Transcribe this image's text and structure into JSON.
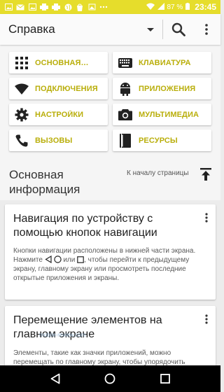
{
  "status_bar": {
    "battery": "87 %",
    "time": "23:45",
    "left_icons": [
      "image-icon",
      "mail-icon",
      "image-icon",
      "printer-icon",
      "printer-icon",
      "globe-icon",
      "shopping-bag-icon",
      "photo-icon",
      "ellipsis-icon"
    ],
    "right_icons": [
      "wifi-icon",
      "signal-icon",
      "battery-icon"
    ]
  },
  "appbar": {
    "title": "Справка",
    "icons": [
      "chevron-down-icon",
      "search-icon",
      "more-vert-icon"
    ]
  },
  "categories": [
    {
      "label": "ОСНОВНАЯ…",
      "icon": "grid-icon"
    },
    {
      "label": "КЛАВИАТУРА",
      "icon": "keyboard-icon"
    },
    {
      "label": "ПОДКЛЮЧЕНИЯ",
      "icon": "wifi-icon"
    },
    {
      "label": "ПРИЛОЖЕНИЯ",
      "icon": "android-icon"
    },
    {
      "label": "НАСТРОЙКИ",
      "icon": "gear-icon"
    },
    {
      "label": "МУЛЬТИМЕДИА",
      "icon": "camera-icon"
    },
    {
      "label": "ВЫЗОВЫ",
      "icon": "phone-icon"
    },
    {
      "label": "РЕСУРСЫ",
      "icon": "book-icon"
    }
  ],
  "section": {
    "title": "Основная информация",
    "to_top_label": "К началу страницы"
  },
  "cards": [
    {
      "title": "Навигация по устройству с помощью кнопок навигации",
      "text_1": "Кнопки навигации расположены в нижней части экрана. Нажмите",
      "text_2": "или",
      "text_3": ", чтобы перейти к предыдущему экрану, главному экрану или просмотреть последние открытые приложения и экраны."
    },
    {
      "title": "Перемещение элементов на главном экране",
      "text": "Элементы, такие как значки приложений, можно перемещать по главному экрану, чтобы упорядочить"
    }
  ],
  "watermark": "mobile-review.com",
  "colors": {
    "status_bar": "#e6dd2b",
    "accent_text": "#b9ae0a",
    "background": "#f5f5f5"
  }
}
